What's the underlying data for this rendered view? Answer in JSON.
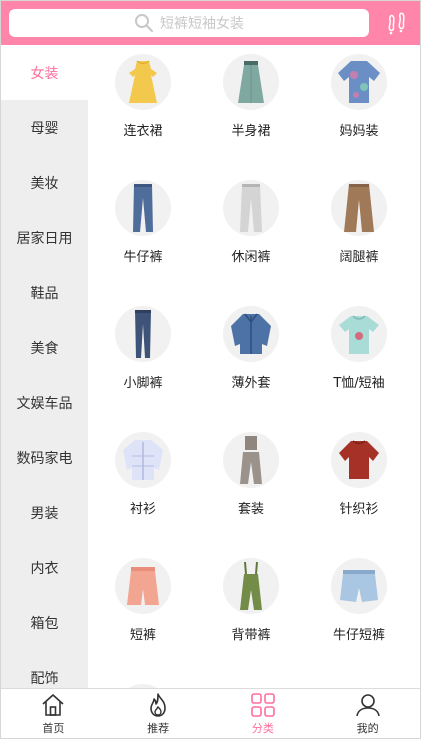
{
  "search": {
    "placeholder": "短裤短袖女装"
  },
  "sidebar": {
    "items": [
      {
        "label": "女装"
      },
      {
        "label": "母婴"
      },
      {
        "label": "美妆"
      },
      {
        "label": "居家日用"
      },
      {
        "label": "鞋品"
      },
      {
        "label": "美食"
      },
      {
        "label": "文娱车品"
      },
      {
        "label": "数码家电"
      },
      {
        "label": "男装"
      },
      {
        "label": "内衣"
      },
      {
        "label": "箱包"
      },
      {
        "label": "配饰"
      }
    ]
  },
  "categories": [
    {
      "label": "连衣裙",
      "icon": "yellow-dress-icon"
    },
    {
      "label": "半身裙",
      "icon": "skirt-icon"
    },
    {
      "label": "妈妈装",
      "icon": "mom-blouse-icon"
    },
    {
      "label": "牛仔裤",
      "icon": "jeans-icon"
    },
    {
      "label": "休闲裤",
      "icon": "casual-pants-icon"
    },
    {
      "label": "阔腿裤",
      "icon": "wide-leg-pants-icon"
    },
    {
      "label": "小脚裤",
      "icon": "skinny-pants-icon"
    },
    {
      "label": "薄外套",
      "icon": "denim-jacket-icon"
    },
    {
      "label": "T恤/短袖",
      "icon": "tshirt-icon"
    },
    {
      "label": "衬衫",
      "icon": "shirt-icon"
    },
    {
      "label": "套装",
      "icon": "suit-set-icon"
    },
    {
      "label": "针织衫",
      "icon": "knit-sweater-icon"
    },
    {
      "label": "短裤",
      "icon": "shorts-icon"
    },
    {
      "label": "背带裤",
      "icon": "overalls-icon"
    },
    {
      "label": "牛仔短裤",
      "icon": "denim-shorts-icon"
    }
  ],
  "tabbar": {
    "home": "首页",
    "recommend": "推荐",
    "category": "分类",
    "mine": "我的"
  },
  "colors": {
    "accent": "#ff85ab",
    "active_text": "#ff6f9c"
  }
}
